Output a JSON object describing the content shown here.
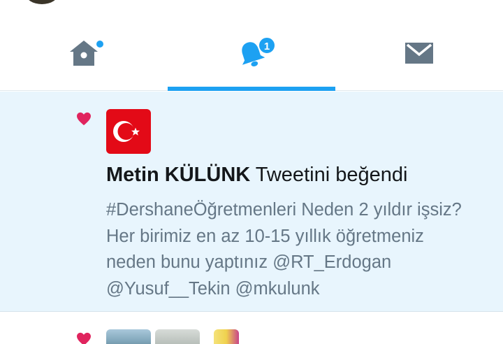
{
  "tabs": [
    {
      "name": "home",
      "icon": "home-icon",
      "has_dot": true
    },
    {
      "name": "notifications",
      "icon": "bell-icon",
      "badge": "1",
      "active": true
    },
    {
      "name": "messages",
      "icon": "envelope-icon"
    }
  ],
  "notification": {
    "icon": "heart-icon",
    "avatar": "turkish-flag-avatar",
    "user_name": "Metin KÜLÜNK",
    "action": "Tweetini beğendi",
    "tweet_lines": [
      "#DershaneÖğretmenleri Neden 2 yıldır işsiz?",
      "Her birimiz en az 10-15 yıllık öğretmeniz",
      "neden bunu yaptınız @RT_Erdogan",
      "@Yusuf__Tekin @mkulunk"
    ]
  },
  "colors": {
    "accent": "#1da1f2",
    "like": "#e0245e",
    "icon_gray": "#657786",
    "highlight_bg": "#e8f5fd",
    "flag_red": "#e30a17"
  }
}
